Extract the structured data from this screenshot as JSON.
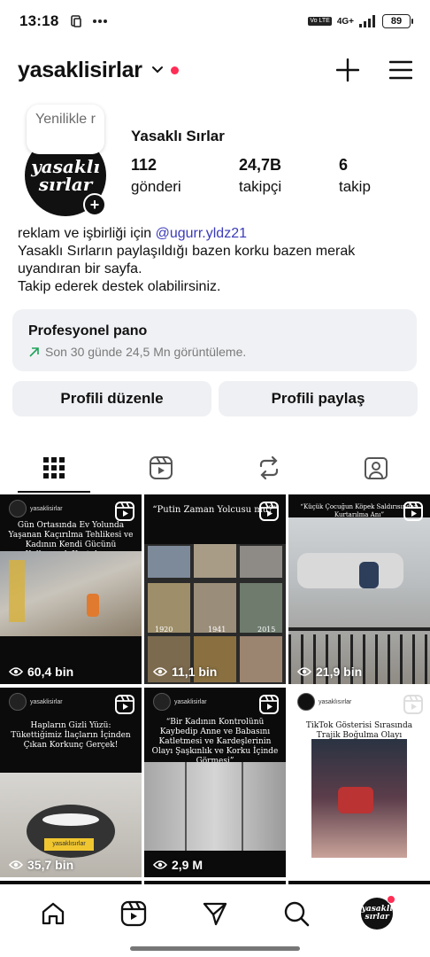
{
  "status_bar": {
    "time": "13:18",
    "network": "4G+",
    "battery": "89"
  },
  "header": {
    "username": "yasaklisirlar"
  },
  "profile": {
    "note": "Yenilikle r",
    "avatar_text_1": "yasaklı",
    "avatar_text_2": "sırlar",
    "display_name": "Yasaklı Sırlar",
    "stats": [
      {
        "num": "112",
        "label": "gönderi"
      },
      {
        "num": "24,7B",
        "label": "takipçi"
      },
      {
        "num": "6",
        "label": "takip"
      }
    ]
  },
  "bio": {
    "line1_prefix": "reklam ve işbirliği için ",
    "mention": "@ugurr.yldz21",
    "line2": "Yasaklı Sırların paylaşıldığı bazen korku bazen merak uyandıran bir sayfa.",
    "line3": "Takip ederek destek olabilirsiniz."
  },
  "pro_dashboard": {
    "title": "Profesyonel pano",
    "subtitle": "Son 30 günde 24,5 Mn görüntüleme.",
    "trend_color": "#1fa35a"
  },
  "buttons": {
    "edit": "Profili düzenle",
    "share": "Profili paylaş"
  },
  "tabs": [
    "grid-icon",
    "reels-icon",
    "reposts-icon",
    "tagged-icon"
  ],
  "posts": [
    {
      "caption": "Gün Ortasında Ev Yolunda Yaşanan Kaçırılma Tehlikesi ve Kadının Kendi Gücünü Kullanarak Kurtulması",
      "account": "yasaklisirlar",
      "views": "60,4 bin"
    },
    {
      "caption": "“Putin Zaman Yolcusu mu?”",
      "years": [
        "1920",
        "1941",
        "2015"
      ],
      "views": "11,1 bin"
    },
    {
      "caption": "“Küçük Çocuğun Köpek Saldırısından Kurtarılma Anı”",
      "views": "21,9 bin"
    },
    {
      "caption": "Hapların Gizli Yüzü: Tükettiğimiz İlaçların İçinden Çıkan Korkunç Gerçek!",
      "account": "yasaklisirlar",
      "tag": "yasaklısırlar",
      "views": "35,7 bin"
    },
    {
      "caption": "“Bir Kadının Kontrolünü Kaybedip Anne ve Babasını Katletmesi ve Kardeşlerinin Olayı Şaşkınlık ve Korku İçinde Görmesi”",
      "account": "yasaklisirlar",
      "views": "2,9 M"
    },
    {
      "caption": "TikTok Gösterisi Sırasında Trajik Boğulma Olayı",
      "account": "yasaklısırlar"
    }
  ],
  "bottom_nav": [
    "home-icon",
    "reels-icon",
    "send-icon",
    "search-icon",
    "profile-avatar"
  ]
}
